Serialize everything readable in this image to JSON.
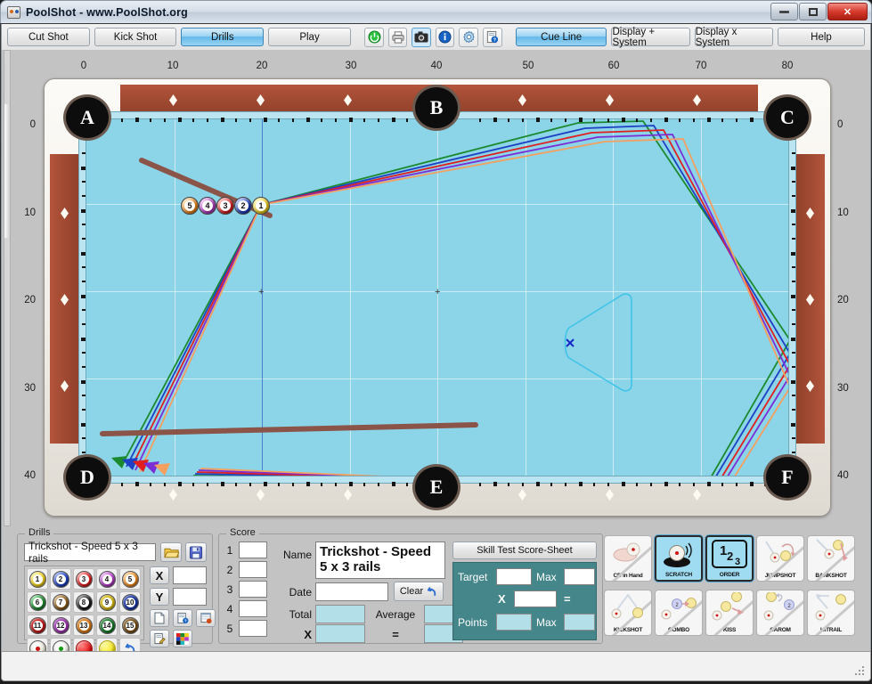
{
  "window": {
    "title": "PoolShot - www.PoolShot.org",
    "icon": "app-icon",
    "minimize": "minimize",
    "maximize": "maximize",
    "close": "close"
  },
  "toolbar": {
    "buttons": [
      {
        "label": "Cut Shot",
        "active": false
      },
      {
        "label": "Kick Shot",
        "active": false
      },
      {
        "label": "Drills",
        "active": true
      },
      {
        "label": "Play",
        "active": false
      }
    ],
    "icons": [
      {
        "name": "power-icon",
        "glyph": "⏻"
      },
      {
        "name": "print-icon",
        "glyph": "🖨"
      },
      {
        "name": "camera-icon",
        "glyph": "📷"
      },
      {
        "name": "info-icon",
        "glyph": "i"
      },
      {
        "name": "settings-icon",
        "glyph": "⚙"
      },
      {
        "name": "doc-help-icon",
        "glyph": "📄"
      }
    ],
    "right_buttons": [
      {
        "label": "Cue Line",
        "active": true
      },
      {
        "label": "Display + System",
        "active": false
      },
      {
        "label": "Display x System",
        "active": false
      },
      {
        "label": "Help",
        "active": false
      }
    ]
  },
  "table": {
    "ruler_top": [
      "0",
      "10",
      "20",
      "30",
      "40",
      "50",
      "60",
      "70",
      "80"
    ],
    "ruler_left": [
      "0",
      "10",
      "20",
      "30",
      "40"
    ],
    "ruler_right": [
      "0",
      "10",
      "20",
      "30",
      "40"
    ],
    "pockets": [
      {
        "label": "A"
      },
      {
        "label": "B"
      },
      {
        "label": "C"
      },
      {
        "label": "D"
      },
      {
        "label": "E"
      },
      {
        "label": "F"
      }
    ],
    "balls": [
      {
        "number": "5",
        "color": "#f08a1e"
      },
      {
        "number": "4",
        "color": "#b33bc6"
      },
      {
        "number": "3",
        "color": "#e01f1f"
      },
      {
        "number": "2",
        "color": "#1d40c4"
      },
      {
        "number": "1",
        "color": "#f2d11a"
      }
    ],
    "cue_ball_marker": "x",
    "rack_outline": "triangle-rack",
    "trajectory_colors": [
      "#1b8a2e",
      "#1d40c4",
      "#e01f1f",
      "#7b2ed6",
      "#f5a05e"
    ],
    "cue_stick_color": "#8a5548",
    "felt_color": "#8cd4e8",
    "rail_color": "#a34b34"
  },
  "drills": {
    "legend": "Drills",
    "name_value": "Trickshot - Speed 5 x 3 rails",
    "open_icon": "open-folder-icon",
    "save_icon": "save-disk-icon",
    "balls": [
      {
        "n": "1",
        "c": "#f2d11a",
        "stripe": false
      },
      {
        "n": "2",
        "c": "#1d40c4",
        "stripe": false
      },
      {
        "n": "3",
        "c": "#e01f1f",
        "stripe": false
      },
      {
        "n": "4",
        "c": "#b33bc6",
        "stripe": false
      },
      {
        "n": "5",
        "c": "#f08a1e",
        "stripe": false
      },
      {
        "n": "6",
        "c": "#1b8a2e",
        "stripe": false
      },
      {
        "n": "7",
        "c": "#8a5a18",
        "stripe": false
      },
      {
        "n": "8",
        "c": "#1a1a1a",
        "stripe": false
      },
      {
        "n": "9",
        "c": "#f2d11a",
        "stripe": true
      },
      {
        "n": "10",
        "c": "#1d40c4",
        "stripe": true
      },
      {
        "n": "11",
        "c": "#e01f1f",
        "stripe": true
      },
      {
        "n": "12",
        "c": "#b33bc6",
        "stripe": true
      },
      {
        "n": "13",
        "c": "#f08a1e",
        "stripe": true
      },
      {
        "n": "14",
        "c": "#1b8a2e",
        "stripe": true
      },
      {
        "n": "15",
        "c": "#8a5a18",
        "stripe": true
      }
    ],
    "extra_balls": [
      {
        "name": "cue-ball-red-dot",
        "c": "#f7f3e8",
        "dot": "#cc1111"
      },
      {
        "name": "cue-ball-green-dot",
        "c": "#f2f7ef",
        "dot": "#119911"
      },
      {
        "name": "red-ball",
        "c": "#e81010",
        "dot": ""
      },
      {
        "name": "yellow-ball",
        "c": "#f2e41a",
        "dot": ""
      }
    ],
    "undo_icon": "undo-arrow-icon",
    "x_label": "X",
    "y_label": "Y",
    "x_value": "",
    "y_value": "",
    "tool_icons": [
      "new-document-icon",
      "doc-help-icon",
      "table-report-icon",
      "edit-note-icon",
      "color-palette-icon"
    ]
  },
  "score": {
    "legend": "Score",
    "rows": [
      "1",
      "2",
      "3",
      "4",
      "5"
    ],
    "row_values": [
      "",
      "",
      "",
      "",
      ""
    ],
    "name_label": "Name",
    "name_value": "Trickshot - Speed 5 x 3 rails",
    "date_label": "Date",
    "date_value": "",
    "clear_label": "Clear",
    "clear_icon": "undo-arrow-icon",
    "total_label": "Total",
    "total_value": "",
    "average_label": "Average",
    "average_value": "",
    "multiply_label": "X",
    "multiply_value": "",
    "equals_label": "=",
    "equals_value": ""
  },
  "skill": {
    "title": "Skill Test Score-Sheet",
    "target_label": "Target",
    "target_value": "",
    "target_max_label": "Max",
    "target_max_value": "",
    "multiply_label": "X",
    "multiply_value": "",
    "equals_label": "=",
    "points_label": "Points",
    "points_value": "",
    "points_max_label": "Max",
    "points_max_value": "",
    "panel_color": "#45868b"
  },
  "shot_types": [
    {
      "label": "CB in Hand",
      "icon": "cb-in-hand-icon",
      "active": false
    },
    {
      "label": "SCRATCH",
      "icon": "scratch-icon",
      "active": true
    },
    {
      "label": "ORDER",
      "icon": "order-123-icon",
      "active": true
    },
    {
      "label": "JUMPSHOT",
      "icon": "jumpshot-icon",
      "active": false
    },
    {
      "label": "BANKSHOT",
      "icon": "bankshot-icon",
      "active": false
    },
    {
      "label": "KICKSHOT",
      "icon": "kickshot-icon",
      "active": false
    },
    {
      "label": "COMBO",
      "icon": "combo-icon",
      "active": false
    },
    {
      "label": "KISS",
      "icon": "kiss-icon",
      "active": false
    },
    {
      "label": "CAROM",
      "icon": "carom-icon",
      "active": false
    },
    {
      "label": "HITRAIL",
      "icon": "hitrail-icon",
      "active": false
    }
  ],
  "statusbar": {
    "text": ""
  }
}
